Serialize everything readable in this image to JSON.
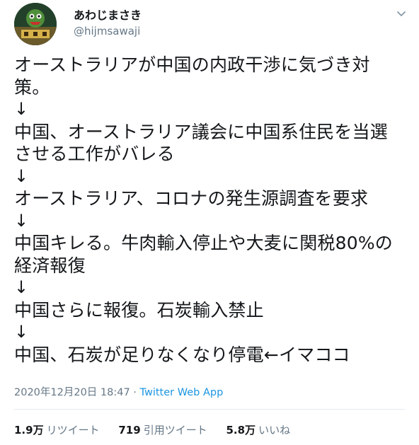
{
  "author": {
    "display_name": "あわじまさき",
    "handle": "@hijmsawaji",
    "avatar_icon": "avatar-image"
  },
  "tweet": {
    "lines": [
      "オーストラリアが中国の内政干渉に気づき対",
      "策。",
      "↓",
      "中国、オーストラリア議会に中国系住民を当選",
      "させる工作がバレる",
      "↓",
      "オーストラリア、コロナの発生源調査を要求",
      "↓",
      "中国キレる。牛肉輸入停止や大麦に関税80%の",
      "経済報復",
      "↓",
      "中国さらに報復。石炭輸入禁止",
      "↓",
      "中国、石炭が足りなくなり停電←イマココ"
    ],
    "timestamp": "2020年12月20日 18:47",
    "separator": " · ",
    "source_app": "Twitter Web App"
  },
  "stats": {
    "retweets_count": "1.9万",
    "retweets_label": "リツイート",
    "quotes_count": "719",
    "quotes_label": "引用ツイート",
    "likes_count": "5.8万",
    "likes_label": "いいね"
  },
  "colors": {
    "text": "#14171a",
    "secondary": "#657786",
    "link": "#1b95e0",
    "divider": "#e6ecf0"
  }
}
